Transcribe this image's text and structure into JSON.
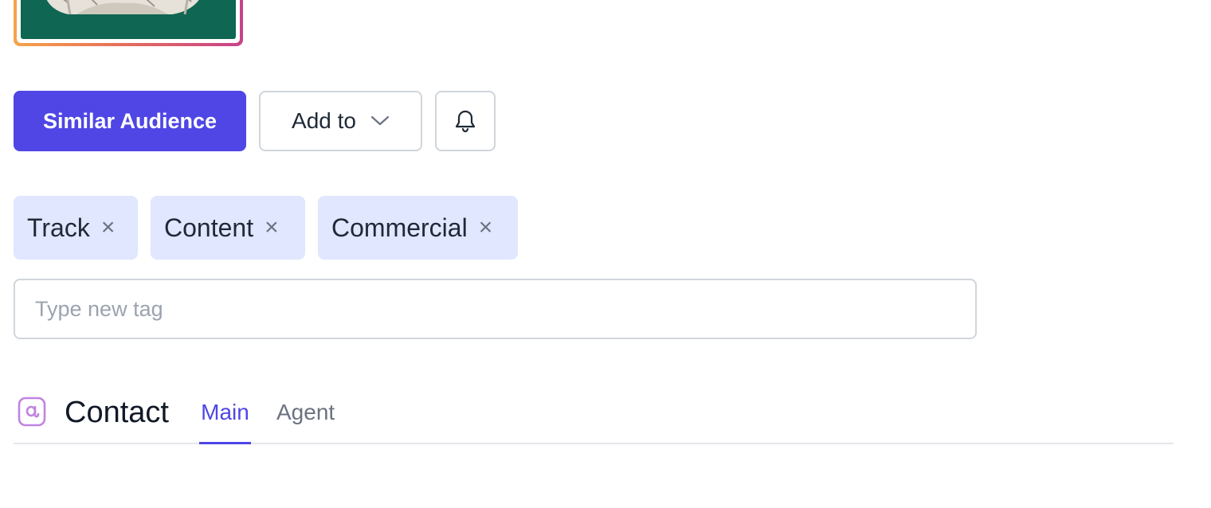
{
  "actions": {
    "similar_audience_label": "Similar Audience",
    "add_to_label": "Add to",
    "bell_icon": "bell-icon",
    "chevron_icon": "chevron-down-icon"
  },
  "tags": {
    "items": [
      {
        "label": "Track",
        "remove_glyph": "×"
      },
      {
        "label": "Content",
        "remove_glyph": "×"
      },
      {
        "label": "Commercial",
        "remove_glyph": "×"
      }
    ],
    "input_placeholder": "Type new tag",
    "tag_bg": "#e0e7ff"
  },
  "contact": {
    "icon": "at-sign-icon",
    "title": "Contact",
    "tabs": [
      {
        "label": "Main",
        "active": true
      },
      {
        "label": "Agent",
        "active": false
      }
    ]
  },
  "colors": {
    "accent": "#4f46e5",
    "avatar_gradient_start": "#f5a44a",
    "avatar_gradient_end": "#c8428a",
    "at_icon": "#c084e0"
  }
}
